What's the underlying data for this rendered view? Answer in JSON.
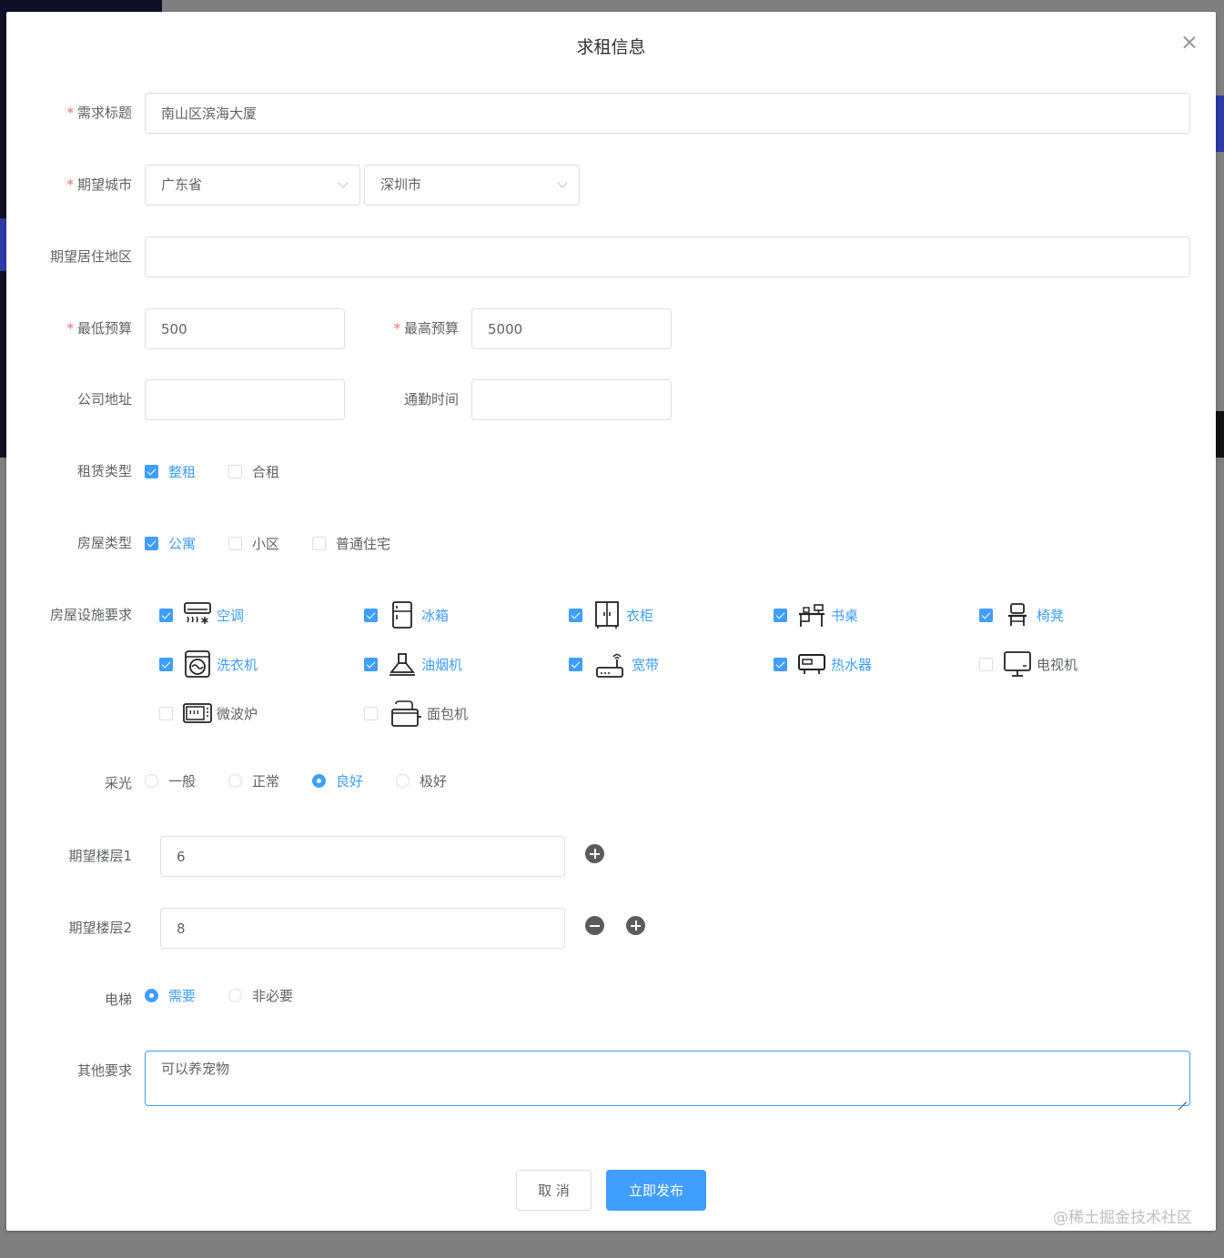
{
  "dialog": {
    "title": "求租信息",
    "close_icon": "close-icon"
  },
  "colors": {
    "primary": "#409eff",
    "required": "#f56c6c",
    "border": "#dcdfe6"
  },
  "form": {
    "title": {
      "label": "需求标题",
      "value": "南山区滨海大厦"
    },
    "city": {
      "label": "期望城市",
      "province": "广东省",
      "city": "深圳市"
    },
    "area": {
      "label": "期望居住地区",
      "value": ""
    },
    "min_budget": {
      "label": "最低预算",
      "value": "500"
    },
    "max_budget": {
      "label": "最高预算",
      "value": "5000"
    },
    "company": {
      "label": "公司地址",
      "value": ""
    },
    "commute": {
      "label": "通勤时间",
      "value": ""
    },
    "rent_type": {
      "label": "租赁类型",
      "options": [
        {
          "label": "整租",
          "checked": true
        },
        {
          "label": "合租",
          "checked": false
        }
      ]
    },
    "house_type": {
      "label": "房屋类型",
      "options": [
        {
          "label": "公寓",
          "checked": true
        },
        {
          "label": "小区",
          "checked": false
        },
        {
          "label": "普通住宅",
          "checked": false
        }
      ]
    },
    "facilities": {
      "label": "房屋设施要求",
      "items": [
        {
          "label": "空调",
          "icon": "air-conditioner-icon",
          "checked": true
        },
        {
          "label": "冰箱",
          "icon": "fridge-icon",
          "checked": true
        },
        {
          "label": "衣柜",
          "icon": "wardrobe-icon",
          "checked": true
        },
        {
          "label": "书桌",
          "icon": "desk-icon",
          "checked": true
        },
        {
          "label": "椅凳",
          "icon": "chair-icon",
          "checked": true
        },
        {
          "label": "洗衣机",
          "icon": "washing-machine-icon",
          "checked": true
        },
        {
          "label": "油烟机",
          "icon": "range-hood-icon",
          "checked": true
        },
        {
          "label": "宽带",
          "icon": "router-icon",
          "checked": true
        },
        {
          "label": "热水器",
          "icon": "water-heater-icon",
          "checked": true
        },
        {
          "label": "电视机",
          "icon": "tv-icon",
          "checked": false
        },
        {
          "label": "微波炉",
          "icon": "microwave-icon",
          "checked": false
        },
        {
          "label": "面包机",
          "icon": "toaster-icon",
          "checked": false
        }
      ]
    },
    "lighting": {
      "label": "采光",
      "options": [
        {
          "label": "一般",
          "checked": false
        },
        {
          "label": "正常",
          "checked": false
        },
        {
          "label": "良好",
          "checked": true
        },
        {
          "label": "极好",
          "checked": false
        }
      ]
    },
    "floor1": {
      "label": "期望楼层1",
      "value": "6"
    },
    "floor2": {
      "label": "期望楼层2",
      "value": "8"
    },
    "elevator": {
      "label": "电梯",
      "options": [
        {
          "label": "需要",
          "checked": true
        },
        {
          "label": "非必要",
          "checked": false
        }
      ]
    },
    "other": {
      "label": "其他要求",
      "value": "可以养宠物"
    }
  },
  "actions": {
    "cancel": "取 消",
    "submit": "立即发布"
  },
  "watermark": "@稀土掘金技术社区"
}
